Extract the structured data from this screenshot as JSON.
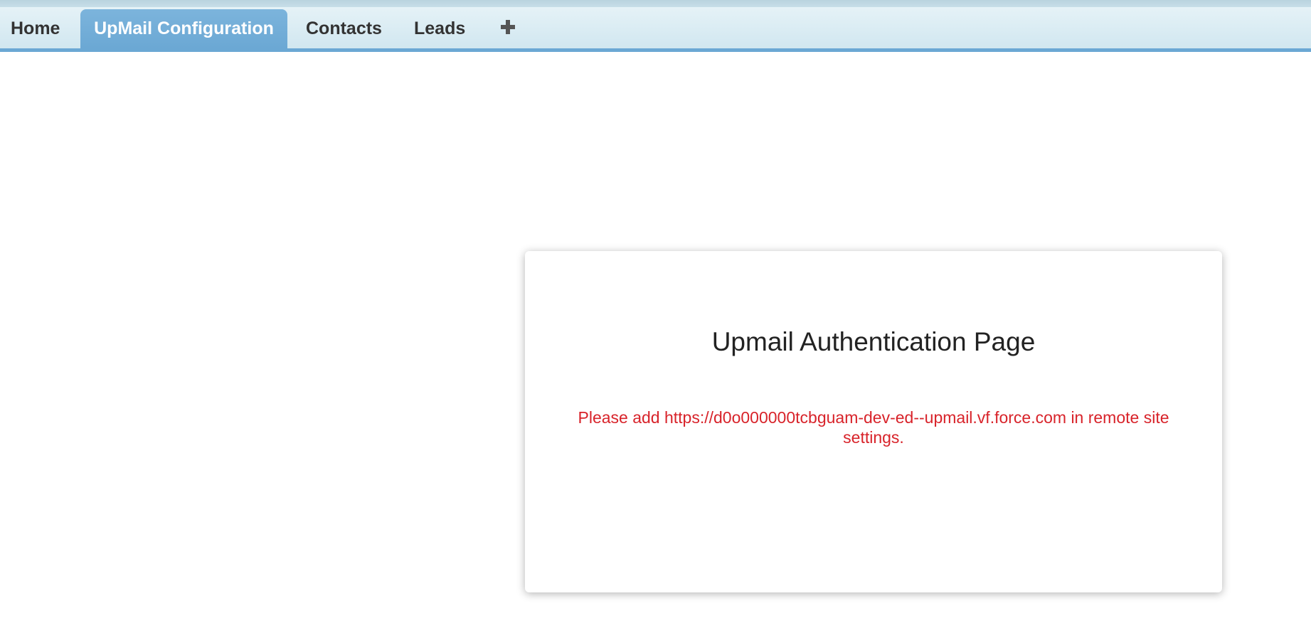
{
  "tabs": [
    {
      "label": "Home",
      "active": false
    },
    {
      "label": "UpMail Configuration",
      "active": true
    },
    {
      "label": "Contacts",
      "active": false
    },
    {
      "label": "Leads",
      "active": false
    }
  ],
  "add_tab_icon": "plus-icon",
  "auth": {
    "title": "Upmail Authentication Page",
    "message": "Please add https://d0o000000tcbguam-dev-ed--upmail.vf.force.com in remote site settings."
  },
  "colors": {
    "tab_active_bg": "#6ba8d4",
    "tabbar_bg": "#d1e7f0",
    "error_text": "#d8232a"
  }
}
